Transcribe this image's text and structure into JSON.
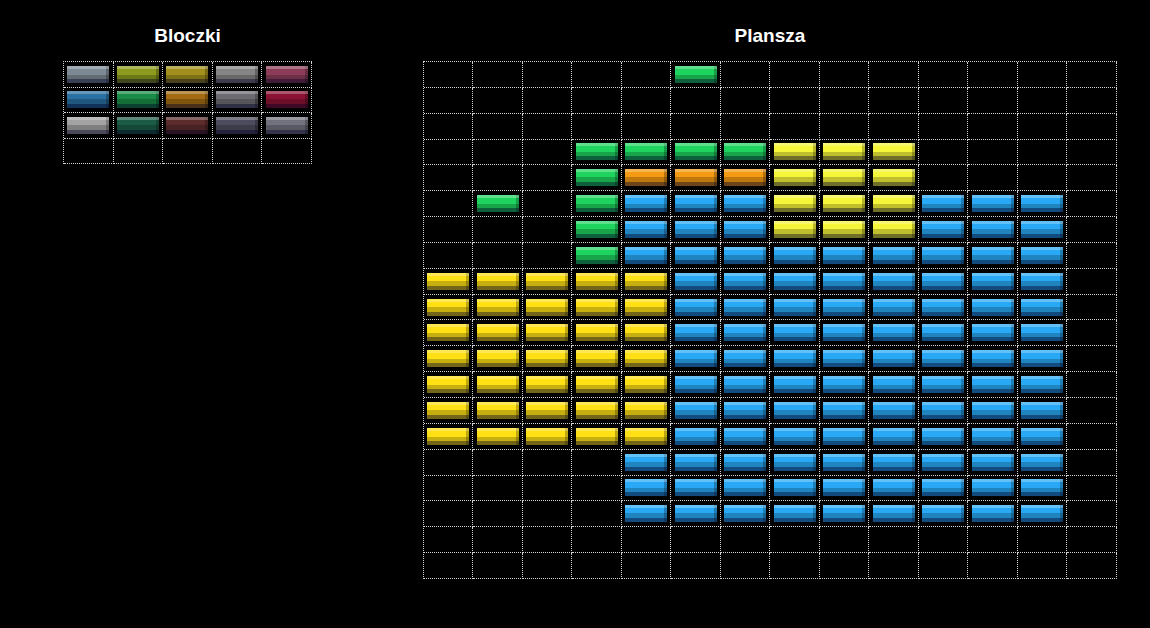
{
  "palette": {
    "title": "Bloczki",
    "tiles": [
      {
        "color": "#7d8a94"
      },
      {
        "color": "#8c9a1e"
      },
      {
        "color": "#a3901c"
      },
      {
        "color": "#858585"
      },
      {
        "color": "#8c3c58"
      },
      {
        "color": "#2a70a3"
      },
      {
        "color": "#1a8c47"
      },
      {
        "color": "#a36b12"
      },
      {
        "color": "#6b6b72"
      },
      {
        "color": "#8c1234"
      },
      {
        "color": "#a3a3a3"
      },
      {
        "color": "#1c5c47"
      },
      {
        "color": "#5c2c2c"
      },
      {
        "color": "#4c4c5e"
      },
      {
        "color": "#72727f"
      },
      {
        "color": null
      },
      {
        "color": null
      },
      {
        "color": null
      },
      {
        "color": null
      },
      {
        "color": null
      }
    ]
  },
  "board": {
    "title": "Plansza",
    "rows": [
      {
        "cells": [
          null,
          null,
          null,
          null,
          null,
          "#1fd35f",
          null,
          null,
          null,
          null,
          null,
          null,
          null,
          null
        ]
      },
      {
        "cells": [
          null,
          null,
          null,
          null,
          null,
          null,
          null,
          null,
          null,
          null,
          null,
          null,
          null,
          null
        ]
      },
      {
        "cells": [
          null,
          null,
          null,
          null,
          null,
          null,
          null,
          null,
          null,
          null,
          null,
          null,
          null,
          null
        ]
      },
      {
        "cells": [
          null,
          null,
          null,
          "#1fd35f",
          "#1fd35f",
          "#1fd35f",
          "#1fd35f",
          "#f5f53a",
          "#f5f53a",
          "#f5f53a",
          null,
          null,
          null,
          null
        ]
      },
      {
        "cells": [
          null,
          null,
          null,
          "#1fd35f",
          "#f39a12",
          "#f39a12",
          "#f39a12",
          "#f5f53a",
          "#f5f53a",
          "#f5f53a",
          null,
          null,
          null,
          null
        ]
      },
      {
        "cells": [
          null,
          "#1fd35f",
          null,
          "#1fd35f",
          "#29a9f5",
          "#29a9f5",
          "#29a9f5",
          "#f5f53a",
          "#f5f53a",
          "#f5f53a",
          "#29a9f5",
          "#29a9f5",
          "#29a9f5",
          null
        ]
      },
      {
        "cells": [
          null,
          null,
          null,
          "#1fd35f",
          "#29a9f5",
          "#29a9f5",
          "#29a9f5",
          "#f5f53a",
          "#f5f53a",
          "#f5f53a",
          "#29a9f5",
          "#29a9f5",
          "#29a9f5",
          null
        ]
      },
      {
        "cells": [
          null,
          null,
          null,
          "#1fd35f",
          "#29a9f5",
          "#29a9f5",
          "#29a9f5",
          "#29a9f5",
          "#29a9f5",
          "#29a9f5",
          "#29a9f5",
          "#29a9f5",
          "#29a9f5",
          null
        ]
      },
      {
        "cells": [
          "#ffe014",
          "#ffe014",
          "#ffe014",
          "#ffe014",
          "#ffe014",
          "#29a9f5",
          "#29a9f5",
          "#29a9f5",
          "#29a9f5",
          "#29a9f5",
          "#29a9f5",
          "#29a9f5",
          "#29a9f5",
          null
        ]
      },
      {
        "cells": [
          "#ffe014",
          "#ffe014",
          "#ffe014",
          "#ffe014",
          "#ffe014",
          "#29a9f5",
          "#29a9f5",
          "#29a9f5",
          "#29a9f5",
          "#29a9f5",
          "#29a9f5",
          "#29a9f5",
          "#29a9f5",
          null
        ]
      },
      {
        "cells": [
          "#ffe014",
          "#ffe014",
          "#ffe014",
          "#ffe014",
          "#ffe014",
          "#29a9f5",
          "#29a9f5",
          "#29a9f5",
          "#29a9f5",
          "#29a9f5",
          "#29a9f5",
          "#29a9f5",
          "#29a9f5",
          null
        ]
      },
      {
        "cells": [
          "#ffe014",
          "#ffe014",
          "#ffe014",
          "#ffe014",
          "#ffe014",
          "#29a9f5",
          "#29a9f5",
          "#29a9f5",
          "#29a9f5",
          "#29a9f5",
          "#29a9f5",
          "#29a9f5",
          "#29a9f5",
          null
        ]
      },
      {
        "cells": [
          "#ffe014",
          "#ffe014",
          "#ffe014",
          "#ffe014",
          "#ffe014",
          "#29a9f5",
          "#29a9f5",
          "#29a9f5",
          "#29a9f5",
          "#29a9f5",
          "#29a9f5",
          "#29a9f5",
          "#29a9f5",
          null
        ]
      },
      {
        "cells": [
          "#ffe014",
          "#ffe014",
          "#ffe014",
          "#ffe014",
          "#ffe014",
          "#29a9f5",
          "#29a9f5",
          "#29a9f5",
          "#29a9f5",
          "#29a9f5",
          "#29a9f5",
          "#29a9f5",
          "#29a9f5",
          null
        ]
      },
      {
        "cells": [
          "#ffe014",
          "#ffe014",
          "#ffe014",
          "#ffe014",
          "#ffe014",
          "#29a9f5",
          "#29a9f5",
          "#29a9f5",
          "#29a9f5",
          "#29a9f5",
          "#29a9f5",
          "#29a9f5",
          "#29a9f5",
          null
        ]
      },
      {
        "cells": [
          null,
          null,
          null,
          null,
          "#29a9f5",
          "#29a9f5",
          "#29a9f5",
          "#29a9f5",
          "#29a9f5",
          "#29a9f5",
          "#29a9f5",
          "#29a9f5",
          "#29a9f5",
          null
        ]
      },
      {
        "cells": [
          null,
          null,
          null,
          null,
          "#29a9f5",
          "#29a9f5",
          "#29a9f5",
          "#29a9f5",
          "#29a9f5",
          "#29a9f5",
          "#29a9f5",
          "#29a9f5",
          "#29a9f5",
          null
        ]
      },
      {
        "cells": [
          null,
          null,
          null,
          null,
          "#29a9f5",
          "#29a9f5",
          "#29a9f5",
          "#29a9f5",
          "#29a9f5",
          "#29a9f5",
          "#29a9f5",
          "#29a9f5",
          "#29a9f5",
          null
        ]
      },
      {
        "cells": [
          null,
          null,
          null,
          null,
          null,
          null,
          null,
          null,
          null,
          null,
          null,
          null,
          null,
          null
        ]
      },
      {
        "cells": [
          null,
          null,
          null,
          null,
          null,
          null,
          null,
          null,
          null,
          null,
          null,
          null,
          null,
          null
        ]
      }
    ]
  }
}
